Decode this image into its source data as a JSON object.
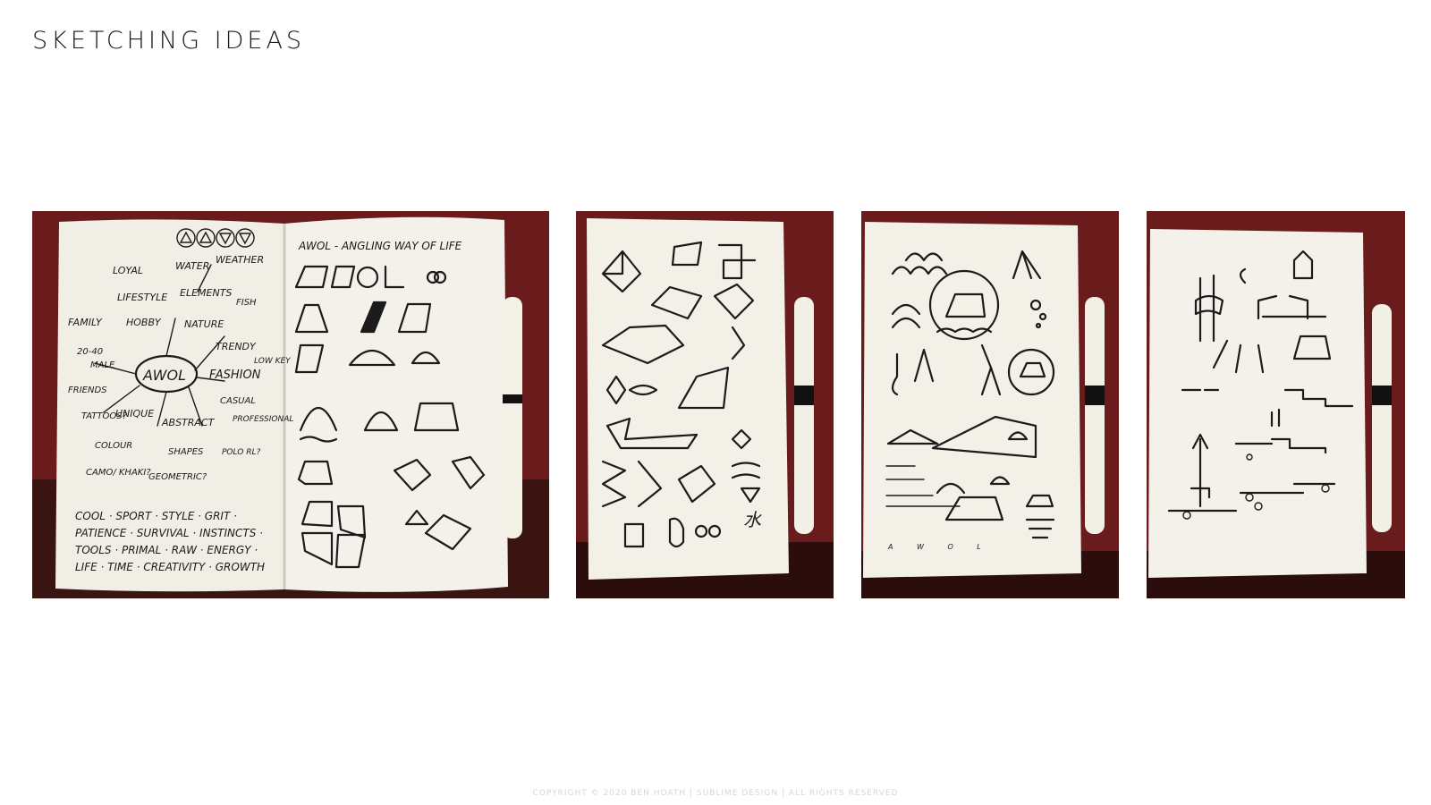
{
  "page": {
    "title": "SKETCHING IDEAS",
    "footer": "COPYRIGHT © 2020 BEN HOATH | SUBLIME DESIGN | ALL RIGHTS RESERVED"
  },
  "sketch_notes": {
    "spread_heading": "AWOL - ANGLING WAY OF LIFE",
    "mind_map_center": "AWOL",
    "mind_map_words": [
      "LOYAL",
      "WATER",
      "WEATHER",
      "LIFESTYLE",
      "ELEMENTS",
      "FISH",
      "FAMILY",
      "HOBBY",
      "NATURE",
      "20-40",
      "MALE",
      "TRENDY",
      "LOW KEY",
      "FRIENDS",
      "FASHION",
      "CASUAL",
      "TATTOOS?",
      "UNIQUE",
      "ABSTRACT",
      "PROFESSIONAL",
      "COLOUR",
      "SHAPES",
      "POLO",
      "RL?",
      "CAMO/",
      "KHAKI?",
      "GEOMETRIC?"
    ],
    "keyword_lines": [
      "COOL · SPORT · STYLE · GRIT ·",
      "PATIENCE · SURVIVAL · INSTINCTS ·",
      "TOOLS · PRIMAL · RAW · ENERGY ·",
      "LIFE · TIME · CREATIVITY · GROWTH"
    ],
    "logo_letters": "A W O L",
    "water_glyph": "水"
  }
}
